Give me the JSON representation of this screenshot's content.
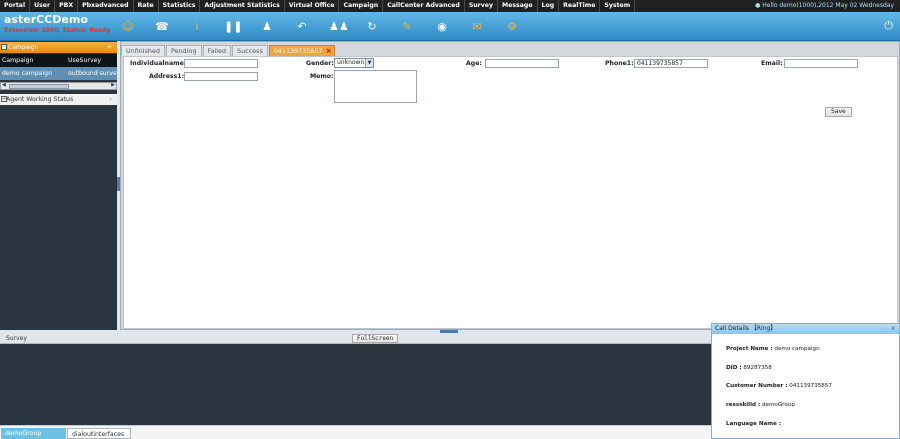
{
  "nav": {
    "items": [
      "Portal",
      "User",
      "PBX",
      "Pbxadvanced",
      "Rate",
      "Statistics",
      "Adjustment Statistics",
      "Virtual Office",
      "Campaign",
      "CallCenter Advanced",
      "Survey",
      "Message",
      "Log",
      "RealTime",
      "System"
    ],
    "greeting": "Hello demo(1000),2012 May 02 Wednesday"
  },
  "header": {
    "brand": "asterCCDemo",
    "status": "Extension: 1000, Status: Ready"
  },
  "toolbar": {
    "icons": [
      "agent-icon",
      "phone-icon",
      "info-icon",
      "pause-icon",
      "transfer-icon",
      "reply-icon",
      "conference-icon",
      "refresh-icon",
      "edit-icon",
      "globe-icon",
      "mail-icon",
      "settings-icon"
    ]
  },
  "left": {
    "campaign_title": "Campaign",
    "plus": "+",
    "col1": "Campaign",
    "col2": "UseSurvey",
    "row_campaign": "demo campaign",
    "row_survey": "outbound survey",
    "agent_status": "Agent Working Status"
  },
  "tabs": [
    "Unfinished",
    "Pending",
    "Failed",
    "Success",
    "041139735857"
  ],
  "form": {
    "name_label": "Individualname:",
    "name_value": "",
    "gender_label": "Gender:",
    "gender_value": "unknown",
    "age_label": "Age:",
    "age_value": "",
    "phone_label": "Phone1:",
    "phone_value": "041139735857",
    "email_label": "Email:",
    "email_value": "",
    "address_label": "Address1:",
    "address_value": "",
    "memo_label": "Memo:",
    "save_label": "Save"
  },
  "bottom": {
    "survey_label": "Survey",
    "fullscreen_label": "FullScreen"
  },
  "footer": {
    "tab1": "demoGroup",
    "tab2": "dialoutinterfaces"
  },
  "call_details": {
    "title": "Call Details  【Ring】",
    "close": "x",
    "project_label": "Project Name :",
    "project_value": "demo campaign",
    "did_label": "DID :",
    "did_value": "89287358",
    "customer_label": "Customer Number :",
    "customer_value": "041139735857",
    "skill_label": "ressskilld :",
    "skill_value": "demoGroup",
    "lang_label": "Language Name :",
    "lang_value": ""
  }
}
